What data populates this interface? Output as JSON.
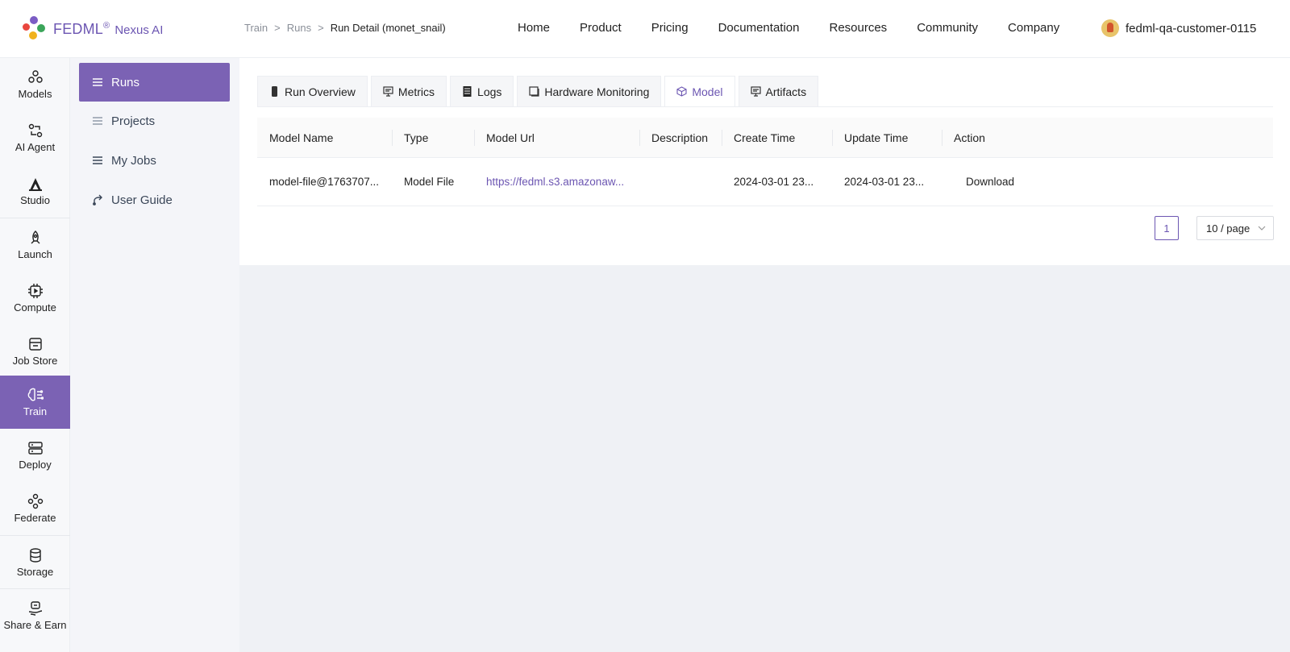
{
  "brand": {
    "name": "FEDML",
    "reg": "®",
    "product": "Nexus AI",
    "color": "#6c56b2"
  },
  "breadcrumb": {
    "items": [
      "Train",
      "Runs",
      "Run Detail (monet_snail)"
    ],
    "separator": ">"
  },
  "topnav": [
    "Home",
    "Product",
    "Pricing",
    "Documentation",
    "Resources",
    "Community",
    "Company"
  ],
  "user": {
    "name": "fedml-qa-customer-0115"
  },
  "rail": [
    {
      "label": "Models",
      "icon": "models-icon"
    },
    {
      "label": "AI Agent",
      "icon": "ai-agent-icon"
    },
    {
      "label": "Studio",
      "icon": "studio-icon"
    },
    {
      "label": "Launch",
      "icon": "rocket-icon"
    },
    {
      "label": "Compute",
      "icon": "chip-icon"
    },
    {
      "label": "Job Store",
      "icon": "store-icon"
    },
    {
      "label": "Train",
      "icon": "brain-icon",
      "active": true
    },
    {
      "label": "Deploy",
      "icon": "server-icon"
    },
    {
      "label": "Federate",
      "icon": "federate-icon"
    },
    {
      "label": "Storage",
      "icon": "database-icon"
    },
    {
      "label": "Share & Earn",
      "icon": "share-icon"
    }
  ],
  "subnav": [
    {
      "label": "Runs",
      "icon": "list-icon",
      "active": true
    },
    {
      "label": "Projects",
      "icon": "list-icon"
    },
    {
      "label": "My Jobs",
      "icon": "list-icon"
    },
    {
      "label": "User Guide",
      "icon": "guide-icon"
    }
  ],
  "tabs": [
    {
      "label": "Run Overview",
      "icon": "phone-icon"
    },
    {
      "label": "Metrics",
      "icon": "monitor-icon"
    },
    {
      "label": "Logs",
      "icon": "document-icon"
    },
    {
      "label": "Hardware Monitoring",
      "icon": "window-icon"
    },
    {
      "label": "Model",
      "icon": "cube-icon",
      "active": true
    },
    {
      "label": "Artifacts",
      "icon": "monitor-icon"
    }
  ],
  "table": {
    "columns": [
      "Model Name",
      "Type",
      "Model Url",
      "Description",
      "Create Time",
      "Update Time",
      "Action"
    ],
    "rows": [
      {
        "name": "model-file@1763707...",
        "type": "Model File",
        "url": "https://fedml.s3.amazonaw...",
        "description": "",
        "create_time": "2024-03-01 23...",
        "update_time": "2024-03-01 23...",
        "action": "Download"
      }
    ]
  },
  "pagination": {
    "current": "1",
    "page_size": "10 / page"
  }
}
